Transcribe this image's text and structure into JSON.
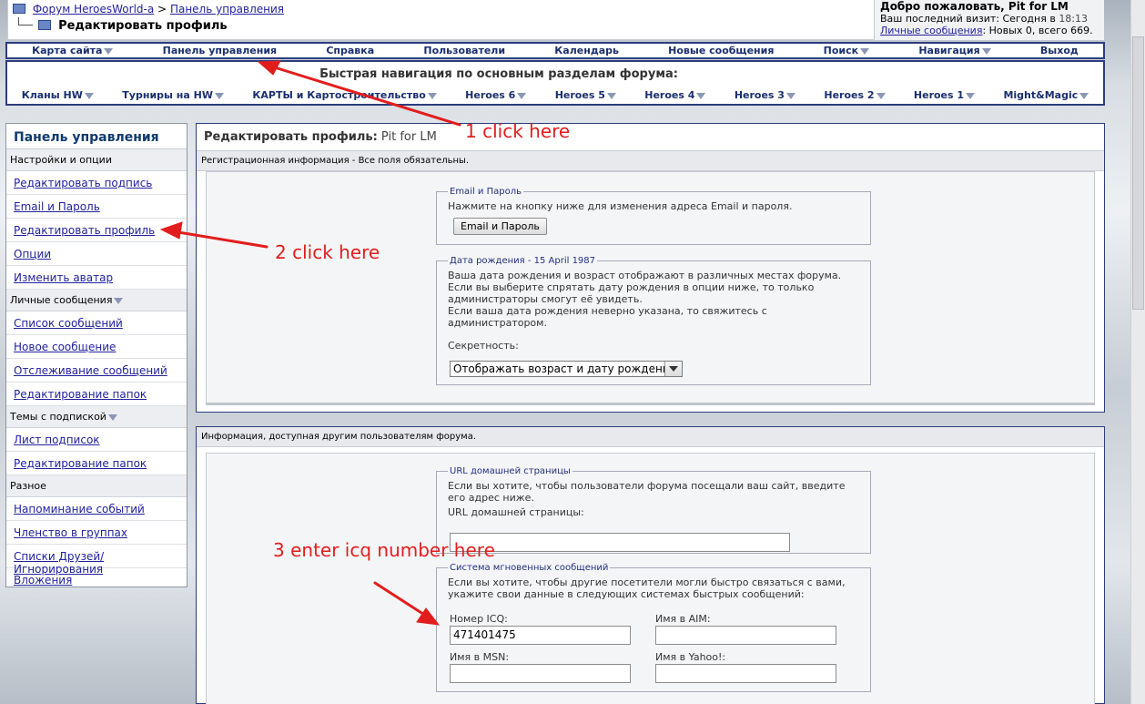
{
  "breadcrumb": {
    "forum": "Форум HeroesWorld-a",
    "separator": ">",
    "current": "Панель управления",
    "page_title": "Редактировать профиль"
  },
  "welcome": {
    "greeting": "Добро пожаловать, Pit for LM",
    "last_visit_label": "Ваш последний визит: Сегодня в",
    "last_visit_time": "18:13",
    "pm_link": "Личные сообщения",
    "pm_counts": ": Новых 0, всего 669."
  },
  "navbar": [
    "Карта сайта",
    "Панель управления",
    "Справка",
    "Пользователи",
    "Календарь",
    "Новые сообщения",
    "Поиск",
    "Навигация",
    "Выход"
  ],
  "navbar_dropdowns": [
    "Карта сайта",
    "Поиск",
    "Навигация"
  ],
  "quick_nav": {
    "title": "Быстрая навигация по основным разделам форума:",
    "items": [
      "Кланы HW",
      "Турниры на HW",
      "КАРТЫ и Картостроительство",
      "Heroes 6",
      "Heroes 5",
      "Heroes 4",
      "Heroes 3",
      "Heroes 2",
      "Heroes 1",
      "Might&Magic"
    ]
  },
  "sidebar": {
    "title": "Панель управления",
    "sections": [
      {
        "label": "Настройки и опции",
        "items": [
          "Редактировать подпись",
          "Email и Пароль",
          "Редактировать профиль",
          "Опции",
          "Изменить аватар"
        ]
      },
      {
        "label": "Личные сообщения",
        "items": [
          "Список сообщений",
          "Новое сообщение",
          "Отслеживание сообщений",
          "Редактирование папок"
        ]
      },
      {
        "label": "Темы с подпиской",
        "items": [
          "Лист подписок",
          "Редактирование папок"
        ]
      },
      {
        "label": "Разное",
        "items": [
          "Напоминание событий",
          "Членство в группах",
          "Списки Друзей/Игнорирования",
          "Вложения"
        ]
      }
    ]
  },
  "main": {
    "title": "Редактировать профиль:",
    "username": "Pit for LM",
    "reg_header": "Регистрационная информация - Все поля обязательны.",
    "email_box": {
      "legend": "Email и Пароль",
      "text": "Нажмите на кнопку ниже для изменения адреса Email и пароля.",
      "button": "Email и Пароль"
    },
    "birthday_box": {
      "legend": "Дата рождения - 15 April 1987",
      "text1": "Ваша дата рождения и возраст отображают в различных местах форума.",
      "text2": "Если вы выберите спрятать дату рождения в опции ниже, то только",
      "text3": "администраторы смогут её увидеть.",
      "text4": "Если ваша дата рождения неверно указана, то свяжитесь с",
      "text5": "администратором.",
      "privacy_label": "Секретность:",
      "privacy_value": "Отображать возраст и дату рождения"
    },
    "public_header": "Информация, доступная другим пользователям форума.",
    "homepage_box": {
      "legend": "URL домашней страницы",
      "text1": "Если вы хотите, чтобы пользователи форума посещали ваш сайт, введите",
      "text2": "его адрес ниже.",
      "field_label": "URL домашней страницы:",
      "value": ""
    },
    "im_box": {
      "legend": "Система мгновенных сообщений",
      "text1": "Если вы хотите, чтобы другие посетители могли быстро связаться с вами,",
      "text2": "укажите свои данные в следующих системах быстрых сообщений:",
      "icq_label": "Номер ICQ:",
      "icq_value": "471401475",
      "aim_label": "Имя в AIM:",
      "aim_value": "",
      "msn_label": "Имя в MSN:",
      "msn_value": "",
      "yahoo_label": "Имя в Yahoo!:",
      "yahoo_value": ""
    }
  },
  "annotations": {
    "step1": "1 click here",
    "step2": "2 click here",
    "step3": "3 enter icq number here",
    "color": "#e21d1d"
  }
}
